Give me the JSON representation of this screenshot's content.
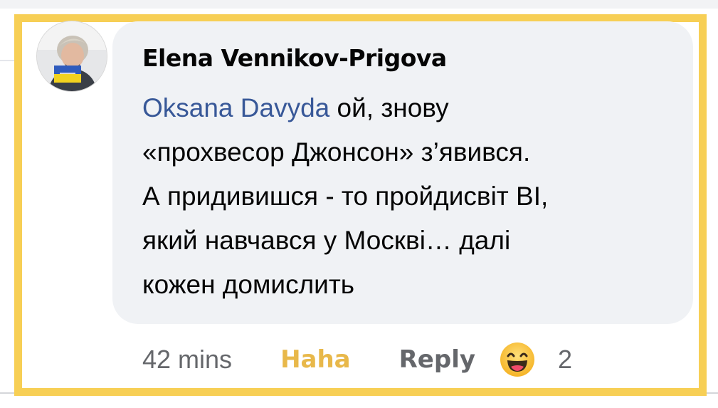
{
  "comment": {
    "author": "Elena Vennikov-Prigova",
    "mention": "Oksana Davyda",
    "lines": [
      " ой, знову",
      "«прохвесор Джонсон» з’явився.",
      "А придивишся - то пройдисвіт ВІ,",
      "який навчався у Москві… далі",
      "кожен домислить"
    ]
  },
  "actions": {
    "time": "42 mins",
    "reaction_label": "Haha",
    "reply_label": "Reply",
    "reaction_icon": "haha-emoji-icon",
    "reaction_count": "2"
  },
  "colors": {
    "highlight": "#f7cf55",
    "mention": "#385898",
    "haha": "#e8b84a",
    "muted": "#65676b",
    "bubble": "#f0f2f5"
  }
}
